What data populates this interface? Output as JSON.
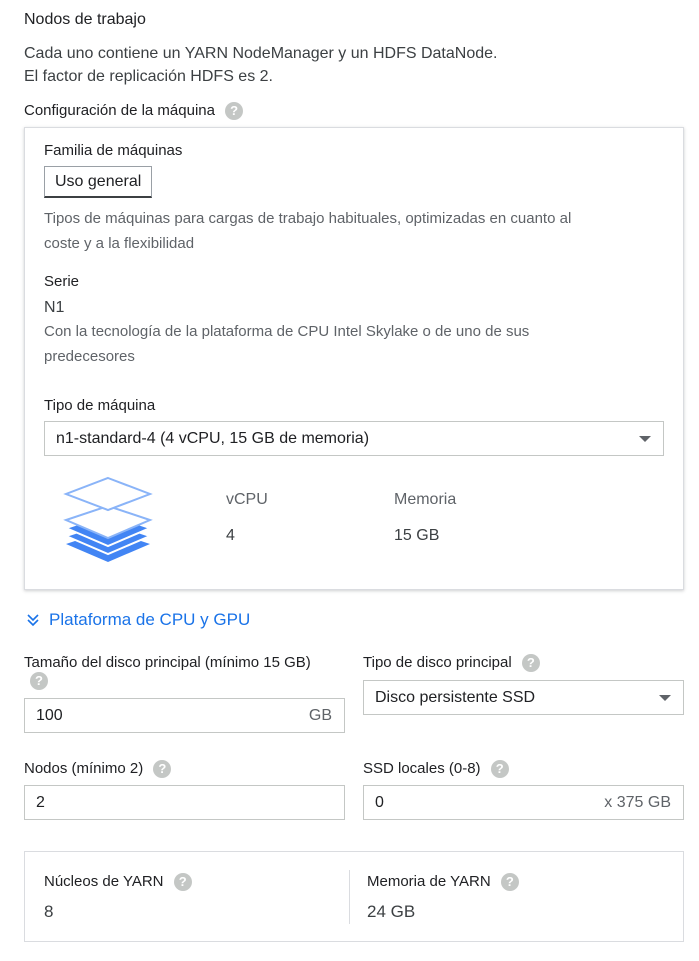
{
  "section": {
    "title": "Nodos de trabajo",
    "desc_line1": "Cada uno contiene un YARN NodeManager y un HDFS DataNode.",
    "desc_line2": "El factor de replicación HDFS es 2."
  },
  "machine_config": {
    "label": "Configuración de la máquina",
    "family_label": "Familia de máquinas",
    "family_button": "Uso general",
    "family_desc_line1": "Tipos de máquinas para cargas de trabajo habituales, optimizadas en cuanto al",
    "family_desc_line2": "coste y a la flexibilidad",
    "series_label": "Serie",
    "series_value": "N1",
    "series_desc_line1": "Con la tecnología de la plataforma de CPU Intel Skylake o de uno de sus",
    "series_desc_line2": "predecesores",
    "machine_type_label": "Tipo de máquina",
    "machine_type_value": "n1-standard-4 (4 vCPU, 15 GB de memoria)",
    "vcpu_label": "vCPU",
    "vcpu_value": "4",
    "memory_label": "Memoria",
    "memory_value": "15 GB"
  },
  "cpu_gpu_link": "Plataforma de CPU y GPU",
  "disk": {
    "size_label": "Tamaño del disco principal (mínimo 15 GB)",
    "size_value": "100",
    "size_unit": "GB",
    "type_label": "Tipo de disco principal",
    "type_value": "Disco persistente SSD"
  },
  "nodes": {
    "label": "Nodos (mínimo 2)",
    "value": "2"
  },
  "local_ssd": {
    "label": "SSD locales (0-8)",
    "value": "0",
    "suffix": "x 375 GB"
  },
  "yarn": {
    "cores_label": "Núcleos de YARN",
    "cores_value": "8",
    "memory_label": "Memoria de YARN",
    "memory_value": "24 GB"
  },
  "colors": {
    "accent": "#1a73e8",
    "help_icon": "#c4c7c5",
    "stack_icon": "#4285f4"
  },
  "icons": {
    "help": "help-circle-icon",
    "stack": "layers-stack-icon",
    "chevron": "chevron-double-down-icon",
    "caret": "caret-down-icon"
  }
}
